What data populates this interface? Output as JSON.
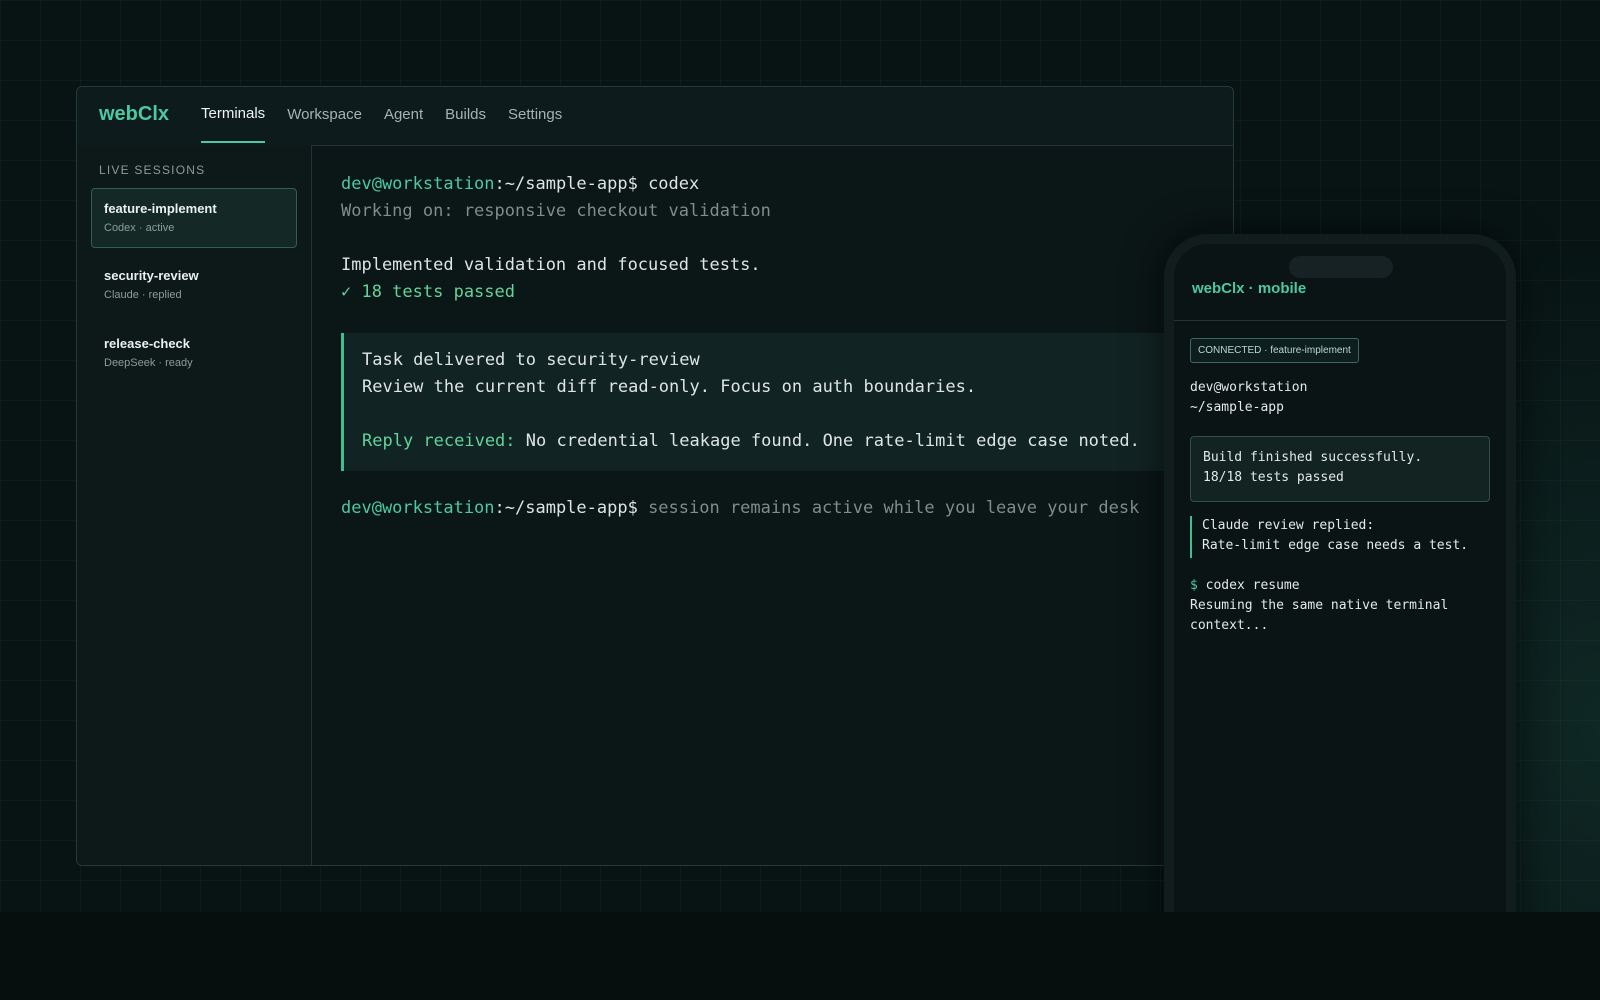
{
  "app": {
    "brand": "webClx"
  },
  "nav": {
    "tabs": [
      {
        "label": "Terminals",
        "active": true
      },
      {
        "label": "Workspace",
        "active": false
      },
      {
        "label": "Agent",
        "active": false
      },
      {
        "label": "Builds",
        "active": false
      },
      {
        "label": "Settings",
        "active": false
      }
    ]
  },
  "sidebar": {
    "heading": "LIVE SESSIONS",
    "sessions": [
      {
        "title": "feature-implement",
        "subtitle": "Codex · active",
        "active": true
      },
      {
        "title": "security-review",
        "subtitle": "Claude · replied",
        "active": false
      },
      {
        "title": "release-check",
        "subtitle": "DeepSeek · ready",
        "active": false
      }
    ]
  },
  "terminal": {
    "prompt_user": "dev@workstation",
    "prompt_path": ":~/sample-app$",
    "command": " codex",
    "working": "Working on: responsive checkout validation",
    "result": "Implemented validation and focused tests.",
    "tests": "✓ 18 tests passed",
    "delivery": {
      "title": "Task delivered to security-review",
      "body": "Review the current diff read-only. Focus on auth boundaries.",
      "reply_label": "Reply received:",
      "reply_text": " No credential leakage found. One rate-limit edge case noted."
    },
    "final_prompt_user": "dev@workstation",
    "final_prompt_path": ":~/sample-app$",
    "final_hint": " session remains active while you leave your desk"
  },
  "phone": {
    "brand": "webClx · mobile",
    "badge": "CONNECTED · feature-implement",
    "user": "dev@workstation",
    "path": "~/sample-app",
    "build_status": "Build finished successfully.",
    "build_tests": "18/18 tests passed",
    "review_title": "Claude review replied:",
    "review_text": "Rate-limit edge case needs a test.",
    "prompt_symbol": "$",
    "command": " codex resume",
    "resume_line1": "Resuming the same native terminal",
    "resume_line2": "context..."
  },
  "colors": {
    "accent": "#4cc9a0",
    "background": "#081414",
    "panel": "#0b1617"
  }
}
